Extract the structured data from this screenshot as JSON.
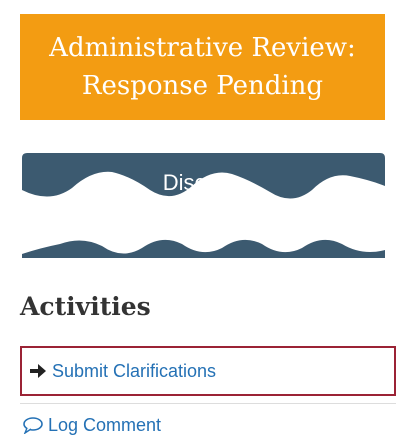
{
  "status": {
    "title": "Administrative Review: Response Pending",
    "color": "#f39c12"
  },
  "disclosures": {
    "label_fragment": "Disc    res",
    "color": "#3c5a70"
  },
  "activities": {
    "heading": "Activities",
    "items": [
      {
        "label": "Submit Clarifications",
        "icon": "arrow-right-icon",
        "selected": true
      },
      {
        "label": "Log Comment",
        "icon": "comment-icon",
        "selected": false
      }
    ],
    "link_color": "#2471b5",
    "highlight_color": "#9b2335"
  }
}
